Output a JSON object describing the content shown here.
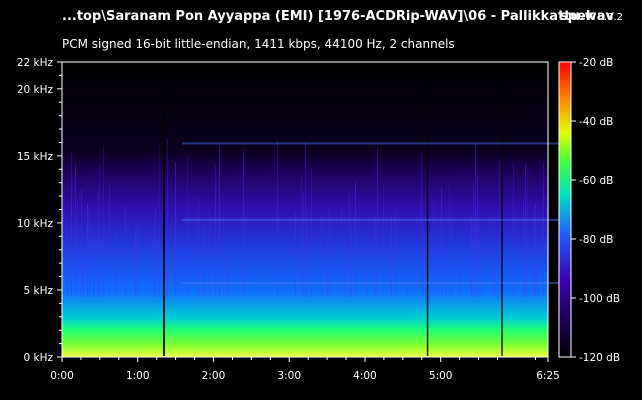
{
  "window": {
    "title": "...top\\Saranam Pon Ayyappa (EMI) [1976-ACDRip-WAV]\\06 - Pallikkattu.wav",
    "app_name": "spek",
    "app_version": "0.8.2",
    "info": "PCM signed 16-bit little-endian, 1411 kbps, 44100 Hz, 2 channels"
  },
  "colors": {
    "background": "#000000",
    "axis": "#ffffff",
    "colormap": [
      "#000000",
      "#1a0050",
      "#3a00b0",
      "#2060ff",
      "#00e0c0",
      "#40ff40",
      "#e0ff00",
      "#ff8000",
      "#ff0000"
    ]
  },
  "chart_data": {
    "type": "heatmap",
    "title": "",
    "x_axis": {
      "unit": "time",
      "range": [
        0,
        385
      ],
      "tick_values": [
        0,
        60,
        120,
        180,
        240,
        300,
        385
      ],
      "tick_labels": [
        "0:00",
        "1:00",
        "2:00",
        "3:00",
        "4:00",
        "5:00",
        "6:25"
      ]
    },
    "y_axis": {
      "unit": "kHz",
      "range": [
        0,
        22
      ],
      "tick_values": [
        0,
        5,
        10,
        15,
        20,
        22
      ],
      "tick_labels": [
        "0 kHz",
        "5 kHz",
        "10 kHz",
        "15 kHz",
        "20 kHz",
        "22 kHz"
      ]
    },
    "color_scale": {
      "range": [
        -120,
        -20
      ],
      "tick_values": [
        -20,
        -40,
        -60,
        -80,
        -100,
        -120
      ],
      "tick_labels": [
        "-20 dB",
        "-40 dB",
        "-60 dB",
        "-80 dB",
        "-100 dB",
        "-120 dB"
      ]
    }
  }
}
